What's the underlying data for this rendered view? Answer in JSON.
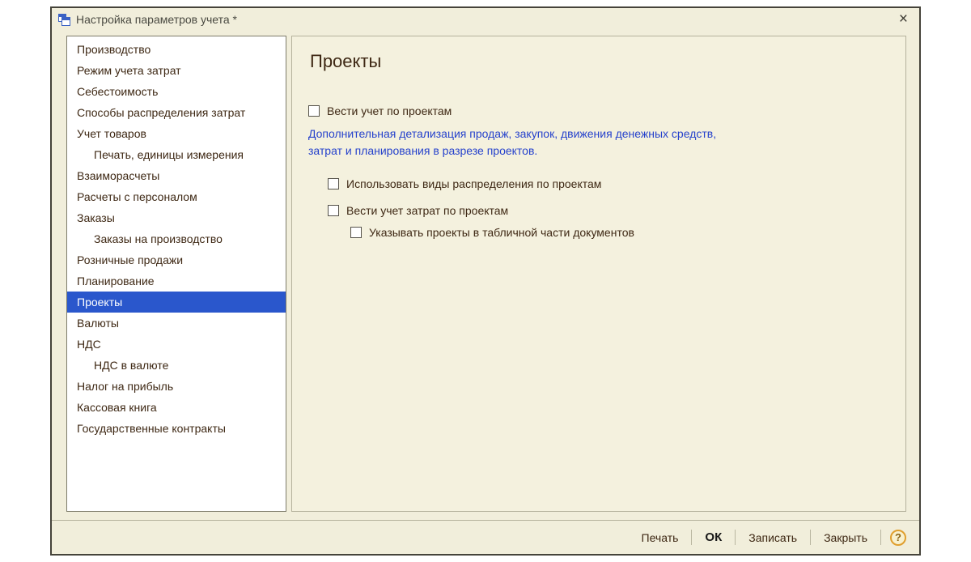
{
  "window": {
    "title": "Настройка параметров учета *"
  },
  "icons": {
    "close": "×",
    "help": "?",
    "app": "form-icon"
  },
  "sidebar": {
    "items": [
      {
        "label": "Производство",
        "indent": 0,
        "selected": false
      },
      {
        "label": "Режим учета затрат",
        "indent": 0,
        "selected": false
      },
      {
        "label": "Себестоимость",
        "indent": 0,
        "selected": false
      },
      {
        "label": "Способы распределения затрат",
        "indent": 0,
        "selected": false
      },
      {
        "label": "Учет товаров",
        "indent": 0,
        "selected": false
      },
      {
        "label": "Печать, единицы измерения",
        "indent": 1,
        "selected": false
      },
      {
        "label": "Взаиморасчеты",
        "indent": 0,
        "selected": false
      },
      {
        "label": "Расчеты с персоналом",
        "indent": 0,
        "selected": false
      },
      {
        "label": "Заказы",
        "indent": 0,
        "selected": false
      },
      {
        "label": "Заказы на производство",
        "indent": 1,
        "selected": false
      },
      {
        "label": "Розничные продажи",
        "indent": 0,
        "selected": false
      },
      {
        "label": "Планирование",
        "indent": 0,
        "selected": false
      },
      {
        "label": "Проекты",
        "indent": 0,
        "selected": true
      },
      {
        "label": "Валюты",
        "indent": 0,
        "selected": false
      },
      {
        "label": "НДС",
        "indent": 0,
        "selected": false
      },
      {
        "label": "НДС в валюте",
        "indent": 1,
        "selected": false
      },
      {
        "label": "Налог на прибыль",
        "indent": 0,
        "selected": false
      },
      {
        "label": "Кассовая книга",
        "indent": 0,
        "selected": false
      },
      {
        "label": "Государственные контракты",
        "indent": 0,
        "selected": false
      }
    ]
  },
  "panel": {
    "title": "Проекты",
    "checkbox_main": {
      "label": "Вести учет по проектам",
      "checked": false
    },
    "description": [
      "Дополнительная детализация продаж, закупок, движения денежных средств,",
      "затрат и планирования в разрезе проектов."
    ],
    "checkbox_distribution": {
      "label": "Использовать виды распределения по проектам",
      "checked": false
    },
    "checkbox_costs": {
      "label": "Вести учет затрат по проектам",
      "checked": false
    },
    "checkbox_tabular": {
      "label": "Указывать проекты в табличной части документов",
      "checked": false
    }
  },
  "footer": {
    "print": "Печать",
    "ok": "ОК",
    "save": "Записать",
    "close": "Закрыть",
    "help": "?"
  },
  "colors": {
    "window_bg": "#f1eedb",
    "panel_bg": "#f4f1de",
    "selection": "#2a57cc",
    "link_text": "#2642cc",
    "label_text": "#3e2814"
  }
}
